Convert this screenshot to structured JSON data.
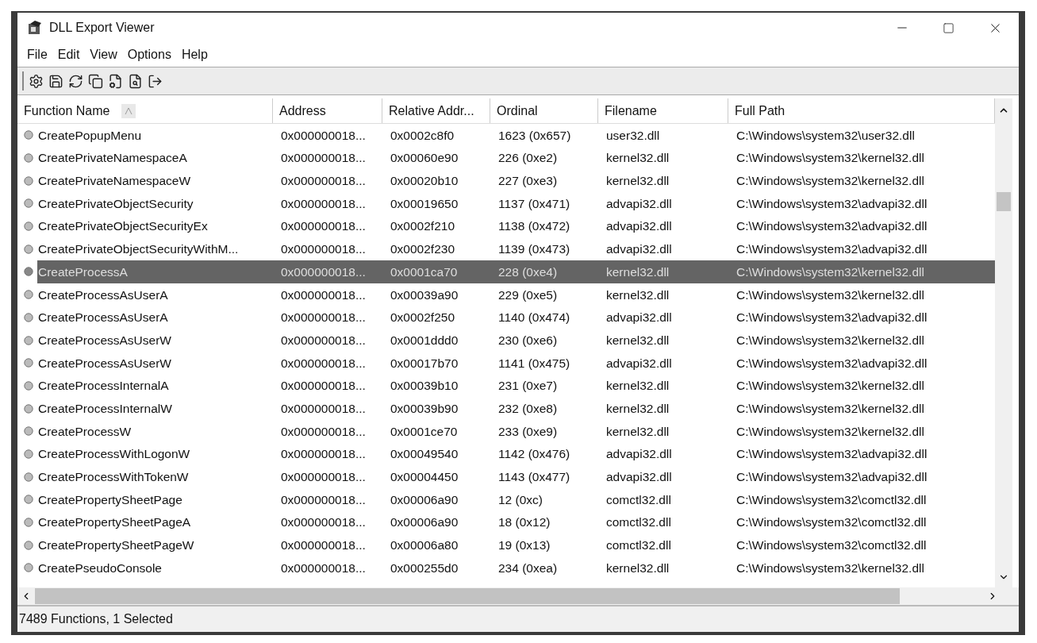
{
  "window": {
    "title": "DLL Export Viewer"
  },
  "menu": [
    "File",
    "Edit",
    "View",
    "Options",
    "Help"
  ],
  "table": {
    "columns": [
      {
        "label": "Function Name",
        "sorted": true
      },
      {
        "label": "Address",
        "sorted": false
      },
      {
        "label": "Relative Addr...",
        "sorted": false
      },
      {
        "label": "Ordinal",
        "sorted": false
      },
      {
        "label": "Filename",
        "sorted": false
      },
      {
        "label": "Full Path",
        "sorted": false
      }
    ],
    "rows": [
      {
        "cells": [
          "CreatePopupMenu",
          "0x000000018...",
          "0x0002c8f0",
          "1623 (0x657)",
          "user32.dll",
          "C:\\Windows\\system32\\user32.dll"
        ],
        "selected": false
      },
      {
        "cells": [
          "CreatePrivateNamespaceA",
          "0x000000018...",
          "0x00060e90",
          "226 (0xe2)",
          "kernel32.dll",
          "C:\\Windows\\system32\\kernel32.dll"
        ],
        "selected": false
      },
      {
        "cells": [
          "CreatePrivateNamespaceW",
          "0x000000018...",
          "0x00020b10",
          "227 (0xe3)",
          "kernel32.dll",
          "C:\\Windows\\system32\\kernel32.dll"
        ],
        "selected": false
      },
      {
        "cells": [
          "CreatePrivateObjectSecurity",
          "0x000000018...",
          "0x00019650",
          "1137 (0x471)",
          "advapi32.dll",
          "C:\\Windows\\system32\\advapi32.dll"
        ],
        "selected": false
      },
      {
        "cells": [
          "CreatePrivateObjectSecurityEx",
          "0x000000018...",
          "0x0002f210",
          "1138 (0x472)",
          "advapi32.dll",
          "C:\\Windows\\system32\\advapi32.dll"
        ],
        "selected": false
      },
      {
        "cells": [
          "CreatePrivateObjectSecurityWithM...",
          "0x000000018...",
          "0x0002f230",
          "1139 (0x473)",
          "advapi32.dll",
          "C:\\Windows\\system32\\advapi32.dll"
        ],
        "selected": false
      },
      {
        "cells": [
          "CreateProcessA",
          "0x000000018...",
          "0x0001ca70",
          "228 (0xe4)",
          "kernel32.dll",
          "C:\\Windows\\system32\\kernel32.dll"
        ],
        "selected": true
      },
      {
        "cells": [
          "CreateProcessAsUserA",
          "0x000000018...",
          "0x00039a90",
          "229 (0xe5)",
          "kernel32.dll",
          "C:\\Windows\\system32\\kernel32.dll"
        ],
        "selected": false
      },
      {
        "cells": [
          "CreateProcessAsUserA",
          "0x000000018...",
          "0x0002f250",
          "1140 (0x474)",
          "advapi32.dll",
          "C:\\Windows\\system32\\advapi32.dll"
        ],
        "selected": false
      },
      {
        "cells": [
          "CreateProcessAsUserW",
          "0x000000018...",
          "0x0001ddd0",
          "230 (0xe6)",
          "kernel32.dll",
          "C:\\Windows\\system32\\kernel32.dll"
        ],
        "selected": false
      },
      {
        "cells": [
          "CreateProcessAsUserW",
          "0x000000018...",
          "0x00017b70",
          "1141 (0x475)",
          "advapi32.dll",
          "C:\\Windows\\system32\\advapi32.dll"
        ],
        "selected": false
      },
      {
        "cells": [
          "CreateProcessInternalA",
          "0x000000018...",
          "0x00039b10",
          "231 (0xe7)",
          "kernel32.dll",
          "C:\\Windows\\system32\\kernel32.dll"
        ],
        "selected": false
      },
      {
        "cells": [
          "CreateProcessInternalW",
          "0x000000018...",
          "0x00039b90",
          "232 (0xe8)",
          "kernel32.dll",
          "C:\\Windows\\system32\\kernel32.dll"
        ],
        "selected": false
      },
      {
        "cells": [
          "CreateProcessW",
          "0x000000018...",
          "0x0001ce70",
          "233 (0xe9)",
          "kernel32.dll",
          "C:\\Windows\\system32\\kernel32.dll"
        ],
        "selected": false
      },
      {
        "cells": [
          "CreateProcessWithLogonW",
          "0x000000018...",
          "0x00049540",
          "1142 (0x476)",
          "advapi32.dll",
          "C:\\Windows\\system32\\advapi32.dll"
        ],
        "selected": false
      },
      {
        "cells": [
          "CreateProcessWithTokenW",
          "0x000000018...",
          "0x00004450",
          "1143 (0x477)",
          "advapi32.dll",
          "C:\\Windows\\system32\\advapi32.dll"
        ],
        "selected": false
      },
      {
        "cells": [
          "CreatePropertySheetPage",
          "0x000000018...",
          "0x00006a90",
          "12 (0xc)",
          "comctl32.dll",
          "C:\\Windows\\system32\\comctl32.dll"
        ],
        "selected": false
      },
      {
        "cells": [
          "CreatePropertySheetPageA",
          "0x000000018...",
          "0x00006a90",
          "18 (0x12)",
          "comctl32.dll",
          "C:\\Windows\\system32\\comctl32.dll"
        ],
        "selected": false
      },
      {
        "cells": [
          "CreatePropertySheetPageW",
          "0x000000018...",
          "0x00006a80",
          "19 (0x13)",
          "comctl32.dll",
          "C:\\Windows\\system32\\comctl32.dll"
        ],
        "selected": false
      },
      {
        "cells": [
          "CreatePseudoConsole",
          "0x000000018...",
          "0x000255d0",
          "234 (0xea)",
          "kernel32.dll",
          "C:\\Windows\\system32\\kernel32.dll"
        ],
        "selected": false
      }
    ]
  },
  "status_bar": "7489 Functions, 1 Selected"
}
